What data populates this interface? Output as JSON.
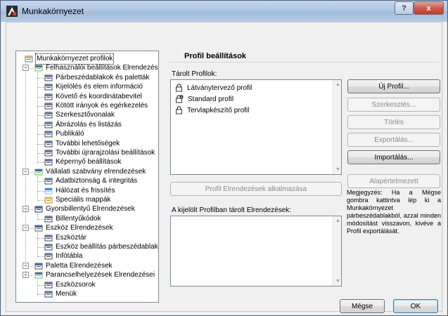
{
  "window": {
    "title": "Munkakörnyezet",
    "help_label": "?",
    "close_label": "x"
  },
  "tree": {
    "items": [
      {
        "label": "Munkakörnyezet profilok",
        "level": 0,
        "icon": "profiles-icon"
      },
      {
        "label": "Felhasználói beállítások Elrendezései",
        "level": 1,
        "icon": "user-settings-icon"
      },
      {
        "label": "Párbeszédablakok és paletták",
        "level": 2,
        "icon": "dialog-palette-icon"
      },
      {
        "label": "Kijelölés és elem információ",
        "level": 2,
        "icon": "selection-icon"
      },
      {
        "label": "Követő és koordinátabevitel",
        "level": 2,
        "icon": "tracker-icon"
      },
      {
        "label": "Kötött irányok és egérkezelés",
        "level": 2,
        "icon": "mouse-constraint-icon"
      },
      {
        "label": "Szerkesztővonalak",
        "level": 2,
        "icon": "guide-lines-icon"
      },
      {
        "label": "Ábrázolás és listázás",
        "level": 2,
        "icon": "imaging-icon"
      },
      {
        "label": "Publikáló",
        "level": 2,
        "icon": "publisher-icon"
      },
      {
        "label": "További lehetőségek",
        "level": 2,
        "icon": "more-options-icon"
      },
      {
        "label": "További újrarajzolási beállítások",
        "level": 2,
        "icon": "redraw-icon"
      },
      {
        "label": "Képernyő beállítások",
        "level": 2,
        "icon": "screen-icon"
      },
      {
        "label": "Vállalati szabvány elrendezések",
        "level": 1,
        "icon": "company-standard-icon"
      },
      {
        "label": "Adatbiztonság & integritás",
        "level": 2,
        "icon": "data-safety-icon"
      },
      {
        "label": "Hálózat és frissítés",
        "level": 2,
        "icon": "network-icon"
      },
      {
        "label": "Speciális mappák",
        "level": 2,
        "icon": "folder-icon"
      },
      {
        "label": "Gyorsbillentyű Elrendezések",
        "level": 1,
        "icon": "shortcut-schemes-icon"
      },
      {
        "label": "Billentyűkódok",
        "level": 2,
        "icon": "keyboard-shortcut-icon"
      },
      {
        "label": "Eszköz Elrendezések",
        "level": 1,
        "icon": "tool-schemes-icon"
      },
      {
        "label": "Eszköztár",
        "level": 2,
        "icon": "toolbox-icon"
      },
      {
        "label": "Eszköz beállítás párbeszédablakok",
        "level": 2,
        "icon": "tool-settings-icon"
      },
      {
        "label": "Infótábla",
        "level": 2,
        "icon": "info-box-icon"
      },
      {
        "label": "Paletta Elrendezések",
        "level": 1,
        "icon": "palette-schemes-icon"
      },
      {
        "label": "Parancselhelyezések Elrendezései",
        "level": 1,
        "icon": "command-layout-icon"
      },
      {
        "label": "Eszközsorok",
        "level": 2,
        "icon": "toolbars-icon"
      },
      {
        "label": "Menük",
        "level": 2,
        "icon": "menus-icon"
      }
    ]
  },
  "profile": {
    "section_title": "Profil beállítások",
    "stored_profiles_label": "Tárolt Profilok:",
    "profiles": [
      {
        "name": "Látványtervező profil",
        "icon": "lock-icon"
      },
      {
        "name": "Standard profil",
        "icon": "lock-check-icon"
      },
      {
        "name": "Tervlapkészítő profil",
        "icon": "lock-icon"
      }
    ],
    "apply_button": "Profil Elrendezések alkalmazása",
    "stored_schemes_label": "A kijelölt Profilban tárolt Elrendezések:",
    "buttons": {
      "new": "Új Profil...",
      "edit": "Szerkesztés...",
      "delete": "Törlés",
      "export": "Exportálás...",
      "import": "Importálás...",
      "default": "Alapértelmezett"
    },
    "note": "Megjegyzés: Ha a Mégse gombra kattintva lép ki a Munkakörnyezet párbeszédablakból, azzal minden módosítást visszavon, kivéve a Profil exportálását."
  },
  "footer": {
    "cancel": "Mégse",
    "ok": "OK"
  }
}
